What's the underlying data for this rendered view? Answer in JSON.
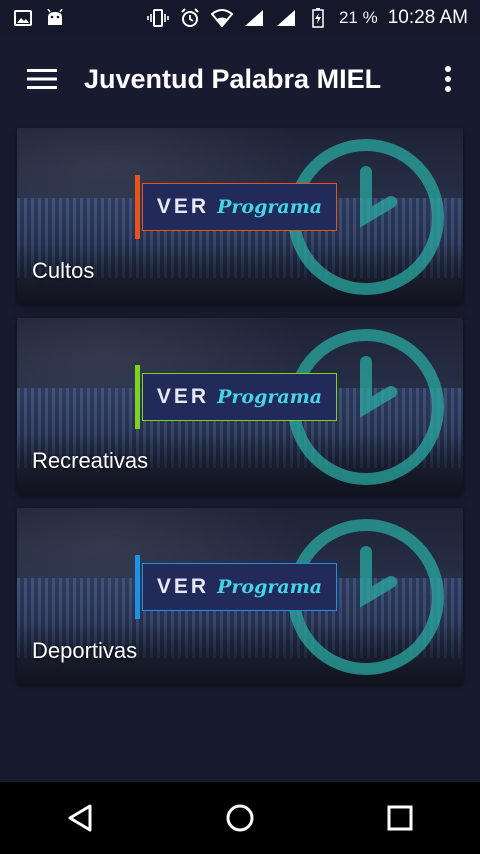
{
  "status_bar": {
    "battery_percent": "21 %",
    "time": "10:28 AM",
    "left_icons": [
      "image-icon",
      "android-icon"
    ],
    "right_icons": [
      "vibrate-icon",
      "alarm-icon",
      "wifi-icon",
      "signal-icon",
      "signal-icon",
      "battery-charging-icon"
    ]
  },
  "app_bar": {
    "title": "Juventud Palabra MIEL",
    "menu_icon": "hamburger-menu-icon",
    "more_icon": "more-vert-icon"
  },
  "banner_text": {
    "ver": "VER",
    "programa": "Programa"
  },
  "cards": [
    {
      "label": "Cultos",
      "accent": "#e8531c"
    },
    {
      "label": "Recreativas",
      "accent": "#7ed321"
    },
    {
      "label": "Deportivas",
      "accent": "#1e90e8"
    }
  ],
  "colors": {
    "background": "#181b2f",
    "clock_teal": "#2aa8a0",
    "programa": "#46d4e6"
  },
  "nav_bar": {
    "icons": [
      "back-icon",
      "home-icon",
      "recents-icon"
    ]
  }
}
